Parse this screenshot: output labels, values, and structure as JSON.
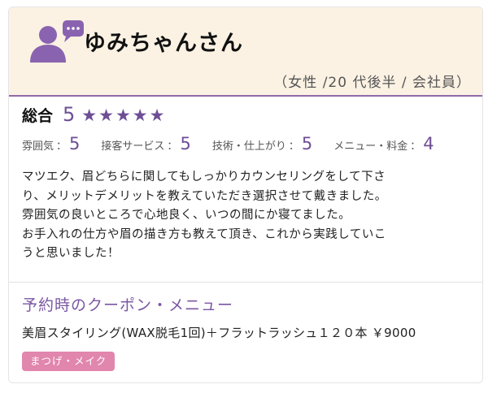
{
  "reviewer": {
    "name": "ゆみちゃんさん",
    "meta": "（女性 /20 代後半 / 会社員）",
    "avatar_icon": "user-chat-icon"
  },
  "overall": {
    "label": "総合",
    "score": "5",
    "stars": 5
  },
  "ratings": [
    {
      "label": "雰囲気",
      "sep": "：",
      "value": "5"
    },
    {
      "label": "接客サービス",
      "sep": "：",
      "value": "5"
    },
    {
      "label": "技術・仕上がり",
      "sep": "：",
      "value": "5"
    },
    {
      "label": "メニュー・料金",
      "sep": "：",
      "value": "4"
    }
  ],
  "review": {
    "lines": [
      "マツエク、眉どちらに関してもしっかりカウンセリングをして下さ",
      "り、メリットデメリットを教えていただき選択させて戴きました。",
      "雰囲気の良いところで心地良く、いつの間にか寝てました。",
      "お手入れの仕方や眉の描き方も教えて頂き、これから実践していこ",
      "うと思いました！"
    ]
  },
  "coupon": {
    "title": "予約時のクーポン・メニュー",
    "text": "美眉スタイリング(WAX脱毛1回)＋フラットラッシュ１２０本 ￥9000",
    "tag": "まつげ・メイク"
  },
  "colors": {
    "accent": "#6e4e95",
    "header_bg": "#fbf2e3",
    "tag_bg": "#e186ad"
  }
}
